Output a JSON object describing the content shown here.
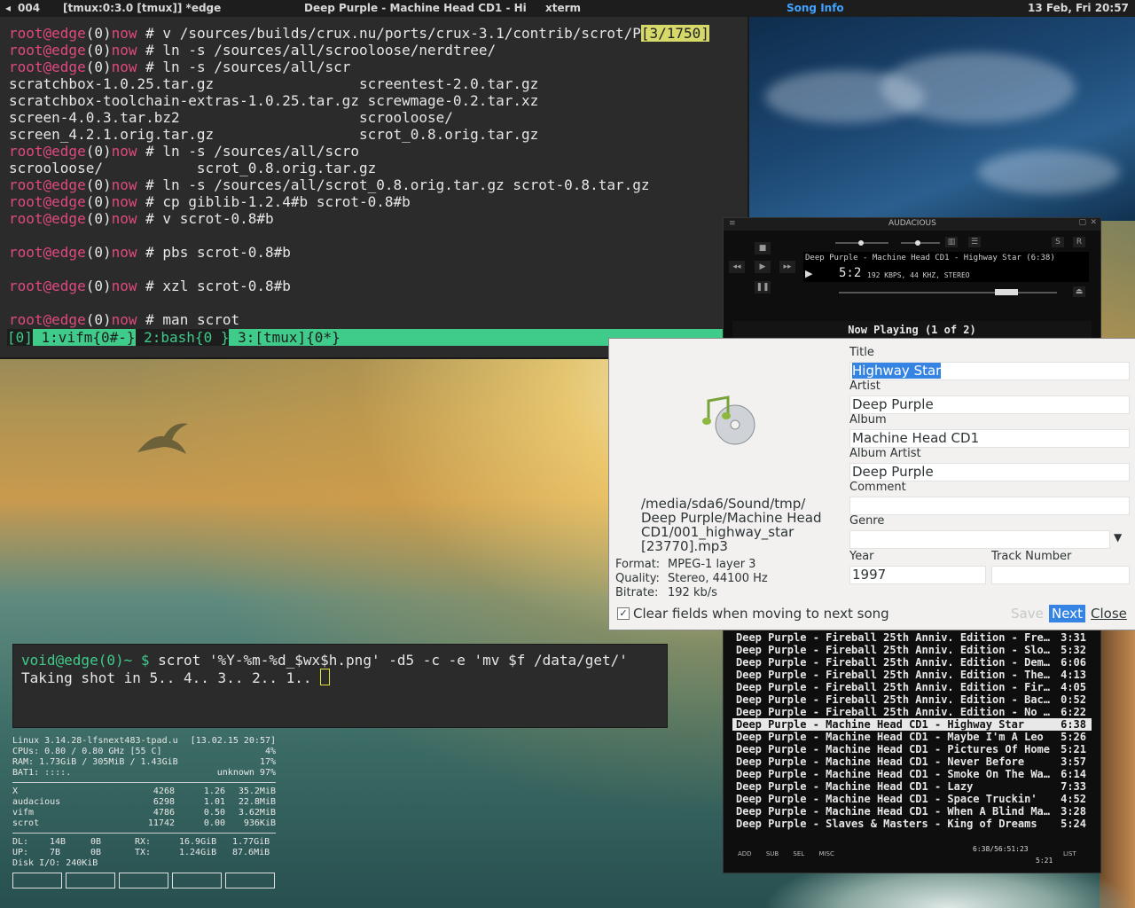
{
  "panel": {
    "workspace": "004",
    "window1": "[tmux:0:3.0 [tmux]] *edge",
    "window2": "Deep Purple - Machine Head CD1 - Hi",
    "window3": "xterm",
    "window4": "Song Info",
    "clock": "13 Feb, Fri 20:57"
  },
  "tmux": {
    "prompt_user": "root@edge",
    "prompt_num": "(0)",
    "prompt_now": "now",
    "prompt_hash": " # ",
    "lines": [
      {
        "cmd": "v /sources/builds/crux.nu/ports/crux-3.1/contrib/scrot/P",
        "badge": "[3/1750]"
      },
      {
        "cmd": "ln -s /sources/all/scrooloose/nerdtree/"
      },
      {
        "cmd": "ln -s /sources/all/scr"
      },
      {
        "out": "scratchbox-1.0.25.tar.gz                 screentest-2.0.tar.gz"
      },
      {
        "out": "scratchbox-toolchain-extras-1.0.25.tar.gz screwmage-0.2.tar.xz"
      },
      {
        "out": "screen-4.0.3.tar.bz2                     scrooloose/"
      },
      {
        "out": "screen_4.2.1.orig.tar.gz                 scrot_0.8.orig.tar.gz"
      },
      {
        "cmd": "ln -s /sources/all/scro"
      },
      {
        "out": "scrooloose/           scrot_0.8.orig.tar.gz"
      },
      {
        "cmd": "ln -s /sources/all/scrot_0.8.orig.tar.gz scrot-0.8.tar.gz"
      },
      {
        "cmd": "cp giblib-1.2.4#b scrot-0.8#b"
      },
      {
        "cmd": "v scrot-0.8#b"
      },
      {
        "blank": true
      },
      {
        "cmd": "pbs scrot-0.8#b"
      },
      {
        "blank": true
      },
      {
        "cmd": "xzl scrot-0.8#b"
      },
      {
        "blank": true
      },
      {
        "cmd": "man scrot"
      }
    ],
    "status_session": "[0]",
    "status_win1": " 1:vifm{0#-}",
    "status_win2": " 2:bash{0 }",
    "status_win3": " 3:[tmux]{0*}"
  },
  "xterm": {
    "prompt": "void@edge(0)~ $ ",
    "command": "scrot '%Y-%m-%d_$wx$h.png' -d5 -c -e 'mv $f /data/get/'",
    "output": "Taking shot in 5.. 4.. 3.. 2.. 1.. "
  },
  "conky": {
    "sys": [
      [
        "Linux 3.14.28-lfsnext483-tpad.u",
        "[13.02.15 20:57]"
      ],
      [
        "CPUs: 0.80 / 0.80 GHz [55 C]",
        "4%"
      ],
      [
        "RAM: 1.73GiB / 305MiB  / 1.43GiB",
        "17%"
      ],
      [
        "BAT1:  ::::.",
        "unknown 97%"
      ]
    ],
    "procs": [
      [
        "X",
        "4268",
        "1.26",
        "35.2MiB"
      ],
      [
        "audacious",
        "6298",
        "1.01",
        "22.8MiB"
      ],
      [
        "vifm",
        "4786",
        "0.50",
        "3.62MiB"
      ],
      [
        "scrot",
        "11742",
        "0.00",
        "936KiB"
      ]
    ],
    "net": [
      [
        "DL:",
        "14B",
        "0B",
        "RX:",
        "16.9GiB",
        "1.77GiB"
      ],
      [
        "UP:",
        "7B",
        "0B",
        "TX:",
        "1.24GiB",
        "87.6MiB"
      ]
    ],
    "disk": "Disk I/O: 240KiB"
  },
  "audacious": {
    "logo": "AUDACIOUS",
    "lcd_song": "Deep Purple - Machine Head CD1 - Highway Star (6:38)",
    "lcd_time": "5:2",
    "lcd_info": "192 KBPS, 44 KHZ, STEREO",
    "now_playing": "Now Playing (1 of 2)",
    "playlist": [
      {
        "t": "Deep Purple - Fireball 25th Anniv. Edition - Fre…",
        "d": "3:31"
      },
      {
        "t": "Deep Purple - Fireball 25th Anniv. Edition - Slo…",
        "d": "5:32"
      },
      {
        "t": "Deep Purple - Fireball 25th Anniv. Edition - Dem…",
        "d": "6:06"
      },
      {
        "t": "Deep Purple - Fireball 25th Anniv. Edition - The…",
        "d": "4:13"
      },
      {
        "t": "Deep Purple - Fireball 25th Anniv. Edition - Fir…",
        "d": "4:05"
      },
      {
        "t": "Deep Purple - Fireball 25th Anniv. Edition - Bac…",
        "d": "0:52"
      },
      {
        "t": "Deep Purple - Fireball 25th Anniv. Edition - No …",
        "d": "6:22"
      },
      {
        "t": "Deep Purple - Machine Head CD1 - Highway Star",
        "d": "6:38",
        "selected": true
      },
      {
        "t": "Deep Purple - Machine Head CD1 - Maybe I'm A Leo",
        "d": "5:26"
      },
      {
        "t": "Deep Purple - Machine Head CD1 - Pictures Of Home",
        "d": "5:21"
      },
      {
        "t": "Deep Purple - Machine Head CD1 - Never Before",
        "d": "3:57"
      },
      {
        "t": "Deep Purple - Machine Head CD1 - Smoke On The Wa…",
        "d": "6:14"
      },
      {
        "t": "Deep Purple - Machine Head CD1 - Lazy",
        "d": "7:33"
      },
      {
        "t": "Deep Purple - Machine Head CD1 - Space Truckin'",
        "d": "4:52"
      },
      {
        "t": "Deep Purple - Machine Head CD1 - When A Blind Ma…",
        "d": "3:28"
      },
      {
        "t": "Deep Purple - Slaves & Masters - King of Dreams",
        "d": "5:24"
      }
    ],
    "bottom": {
      "add": "ADD",
      "sub": "SUB",
      "sel": "SEL",
      "misc": "MISC",
      "list": "LIST",
      "total": "6:38/56:51:23",
      "elapsed": "5:21"
    }
  },
  "song_info": {
    "title_label": "Title",
    "title_value": "Highway Star",
    "artist_label": "Artist",
    "artist_value": "Deep Purple",
    "album_label": "Album",
    "album_value": "Machine Head CD1",
    "album_artist_label": "Album Artist",
    "album_artist_value": "Deep Purple",
    "comment_label": "Comment",
    "comment_value": "",
    "genre_label": "Genre",
    "genre_value": "",
    "year_label": "Year",
    "year_value": "1997",
    "track_label": "Track Number",
    "track_value": "",
    "path_lines": [
      "/media/sda6/Sound/tmp/",
      "Deep Purple/Machine Head",
      "CD1/001_highway_star",
      "[23770].mp3"
    ],
    "format_key": "Format:",
    "format_val": "MPEG-1 layer 3",
    "quality_key": "Quality:",
    "quality_val": "Stereo, 44100 Hz",
    "bitrate_key": "Bitrate:",
    "bitrate_val": "192 kb/s",
    "clear_label": "Clear fields when moving to next song",
    "save": "Save",
    "next": "Next",
    "close": "Close"
  },
  "colors": {
    "prompt": "#e0497f",
    "status_bar": "#3fcb8a",
    "accent": "#3584e4",
    "active_panel": "#3fa3ff"
  }
}
